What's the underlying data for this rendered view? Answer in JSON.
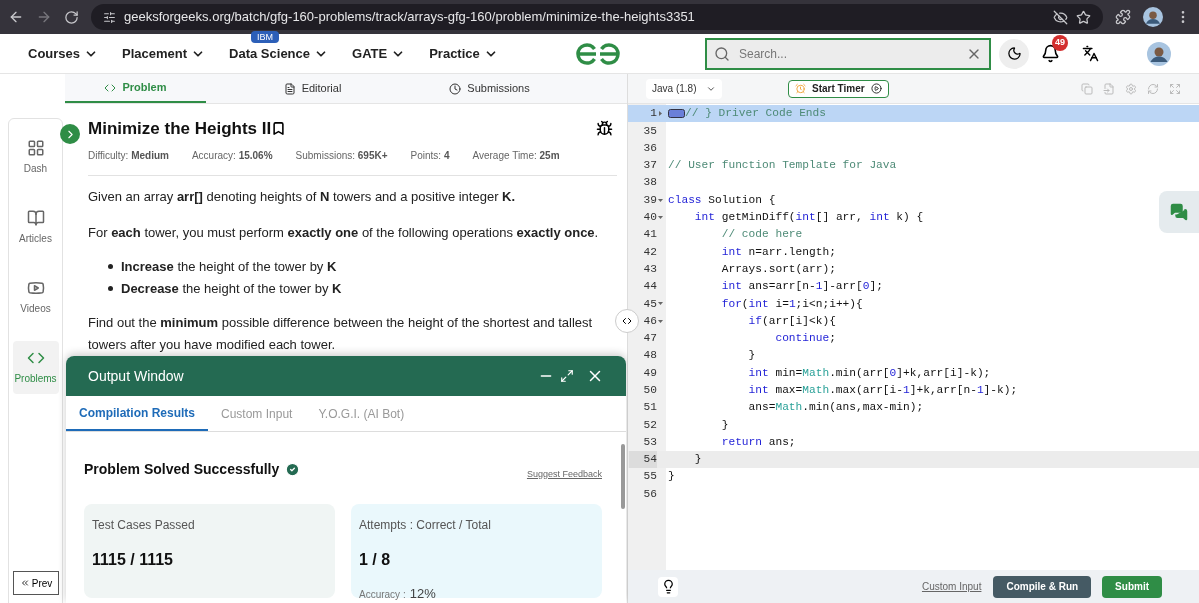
{
  "browser": {
    "url": "geeksforgeeks.org/batch/gfg-160-problems/track/arrays-gfg-160/problem/minimize-the-heights3351"
  },
  "nav": {
    "items": [
      {
        "label": "Courses"
      },
      {
        "label": "Placement"
      },
      {
        "label": "Data Science",
        "badge": "IBM"
      },
      {
        "label": "GATE"
      },
      {
        "label": "Practice"
      }
    ],
    "search": {
      "placeholder": "Search..."
    },
    "notifications": "49"
  },
  "problem_tabs": [
    {
      "label": "Problem",
      "selected": true,
      "kind": "code"
    },
    {
      "label": "Editorial",
      "selected": false,
      "kind": "doc"
    },
    {
      "label": "Submissions",
      "selected": false,
      "kind": "clock"
    }
  ],
  "sidebar": {
    "items": [
      {
        "label": "Dash",
        "kind": "dash",
        "selected": false
      },
      {
        "label": "Articles",
        "kind": "book",
        "selected": false
      },
      {
        "label": "Videos",
        "kind": "video",
        "selected": false
      },
      {
        "label": "Problems",
        "kind": "code",
        "selected": true
      }
    ],
    "prev": "Prev"
  },
  "problem": {
    "title": "Minimize the Heights II",
    "stats": [
      {
        "label": "Difficulty:",
        "value": "Medium"
      },
      {
        "label": "Accuracy:",
        "value": "15.06%"
      },
      {
        "label": "Submissions:",
        "value": "695K+"
      },
      {
        "label": "Points:",
        "value": "4"
      },
      {
        "label": "Average Time:",
        "value": "25m"
      }
    ],
    "paragraphs": [
      "Given an array **arr[]** denoting heights of **N** towers and a positive integer **K.**",
      "For **each** tower, you must perform **exactly one** of the following operations **exactly once**."
    ],
    "bullets": [
      "**Increase** the height of the tower by **K**",
      "**Decrease** the height of the tower by **K**"
    ],
    "closing": "Find out the **minimum** possible difference between the height of the shortest and tallest towers after you have modified each tower."
  },
  "output_window": {
    "title": "Output Window",
    "tabs": [
      {
        "label": "Compilation Results",
        "selected": true
      },
      {
        "label": "Custom Input",
        "selected": false
      },
      {
        "label": "Y.O.G.I. (AI Bot)",
        "selected": false
      }
    ],
    "status": "Problem Solved Successfully",
    "feedback": "Suggest Feedback",
    "cards": [
      {
        "kind": "tests",
        "label": "Test Cases Passed",
        "value": "1115 / 1115"
      },
      {
        "kind": "attempts",
        "label": "Attempts : Correct / Total",
        "value": "1 / 8",
        "accuracy_label": "Accuracy :",
        "accuracy": "12%"
      }
    ]
  },
  "editor": {
    "language": "Java (1.8)",
    "timer": "Start Timer",
    "lines": [
      {
        "number": "1",
        "fold": true,
        "selected": true,
        "cursor": false,
        "collapsed": true,
        "tokens": [
          {
            "text": "// } Driver Code Ends",
            "kind": "comment"
          }
        ]
      },
      {
        "number": "35",
        "fold": false,
        "selected": false,
        "cursor": false,
        "collapsed": false
      },
      {
        "number": "36",
        "fold": false,
        "selected": false,
        "cursor": false,
        "collapsed": false
      },
      {
        "number": "37",
        "fold": false,
        "selected": false,
        "cursor": false,
        "collapsed": false,
        "tokens": [
          {
            "text": "// User function Template for Java",
            "kind": "comment"
          }
        ]
      },
      {
        "number": "38",
        "fold": false,
        "selected": false,
        "cursor": false,
        "collapsed": false
      },
      {
        "number": "39",
        "fold": true,
        "selected": false,
        "cursor": false,
        "collapsed": false,
        "tokens": [
          {
            "text": "class",
            "kind": "keyword"
          },
          {
            "text": " Solution {",
            "kind": "plain"
          }
        ]
      },
      {
        "number": "40",
        "fold": true,
        "selected": false,
        "cursor": false,
        "collapsed": false,
        "tokens": [
          {
            "text": "    int",
            "kind": "keyword"
          },
          {
            "text": " getMinDiff(",
            "kind": "plain"
          },
          {
            "text": "int",
            "kind": "keyword"
          },
          {
            "text": "[] arr, ",
            "kind": "plain"
          },
          {
            "text": "int",
            "kind": "keyword"
          },
          {
            "text": " k) {",
            "kind": "plain"
          }
        ]
      },
      {
        "number": "41",
        "fold": false,
        "selected": false,
        "cursor": false,
        "collapsed": false,
        "tokens": [
          {
            "text": "        // code here",
            "kind": "comment"
          }
        ]
      },
      {
        "number": "42",
        "fold": false,
        "selected": false,
        "cursor": false,
        "collapsed": false,
        "tokens": [
          {
            "text": "        int",
            "kind": "keyword"
          },
          {
            "text": " n=arr.length;",
            "kind": "plain"
          }
        ]
      },
      {
        "number": "43",
        "fold": false,
        "selected": false,
        "cursor": false,
        "collapsed": false,
        "tokens": [
          {
            "text": "        Arrays.sort(arr);",
            "kind": "plain"
          }
        ]
      },
      {
        "number": "44",
        "fold": false,
        "selected": false,
        "cursor": false,
        "collapsed": false,
        "tokens": [
          {
            "text": "        int",
            "kind": "keyword"
          },
          {
            "text": " ans=arr[n-",
            "kind": "plain"
          },
          {
            "text": "1",
            "kind": "number"
          },
          {
            "text": "]-arr[",
            "kind": "plain"
          },
          {
            "text": "0",
            "kind": "number"
          },
          {
            "text": "];",
            "kind": "plain"
          }
        ]
      },
      {
        "number": "45",
        "fold": true,
        "selected": false,
        "cursor": false,
        "collapsed": false,
        "tokens": [
          {
            "text": "        for",
            "kind": "keyword"
          },
          {
            "text": "(",
            "kind": "plain"
          },
          {
            "text": "int",
            "kind": "keyword"
          },
          {
            "text": " i=",
            "kind": "plain"
          },
          {
            "text": "1",
            "kind": "number"
          },
          {
            "text": ";i<n;i++){",
            "kind": "plain"
          }
        ]
      },
      {
        "number": "46",
        "fold": true,
        "selected": false,
        "cursor": false,
        "collapsed": false,
        "tokens": [
          {
            "text": "            if",
            "kind": "keyword"
          },
          {
            "text": "(arr[i]<k){",
            "kind": "plain"
          }
        ]
      },
      {
        "number": "47",
        "fold": false,
        "selected": false,
        "cursor": false,
        "collapsed": false,
        "tokens": [
          {
            "text": "                continue",
            "kind": "keyword"
          },
          {
            "text": ";",
            "kind": "plain"
          }
        ]
      },
      {
        "number": "48",
        "fold": false,
        "selected": false,
        "cursor": false,
        "collapsed": false,
        "tokens": [
          {
            "text": "            }",
            "kind": "plain"
          }
        ]
      },
      {
        "number": "49",
        "fold": false,
        "selected": false,
        "cursor": false,
        "collapsed": false,
        "tokens": [
          {
            "text": "            int",
            "kind": "keyword"
          },
          {
            "text": " min=",
            "kind": "plain"
          },
          {
            "text": "Math",
            "kind": "builtin"
          },
          {
            "text": ".min(arr[",
            "kind": "plain"
          },
          {
            "text": "0",
            "kind": "number"
          },
          {
            "text": "]+k,arr[i]-k);",
            "kind": "plain"
          }
        ]
      },
      {
        "number": "50",
        "fold": false,
        "selected": false,
        "cursor": false,
        "collapsed": false,
        "tokens": [
          {
            "text": "            int",
            "kind": "keyword"
          },
          {
            "text": " max=",
            "kind": "plain"
          },
          {
            "text": "Math",
            "kind": "builtin"
          },
          {
            "text": ".max(arr[i-",
            "kind": "plain"
          },
          {
            "text": "1",
            "kind": "number"
          },
          {
            "text": "]+k,arr[n-",
            "kind": "plain"
          },
          {
            "text": "1",
            "kind": "number"
          },
          {
            "text": "]-k);",
            "kind": "plain"
          }
        ]
      },
      {
        "number": "51",
        "fold": false,
        "selected": false,
        "cursor": false,
        "collapsed": false,
        "tokens": [
          {
            "text": "            ans=",
            "kind": "plain"
          },
          {
            "text": "Math",
            "kind": "builtin"
          },
          {
            "text": ".min(ans,max-min);",
            "kind": "plain"
          }
        ]
      },
      {
        "number": "52",
        "fold": false,
        "selected": false,
        "cursor": false,
        "collapsed": false,
        "tokens": [
          {
            "text": "        }",
            "kind": "plain"
          }
        ]
      },
      {
        "number": "53",
        "fold": false,
        "selected": false,
        "cursor": false,
        "collapsed": false,
        "tokens": [
          {
            "text": "        return",
            "kind": "keyword"
          },
          {
            "text": " ans;",
            "kind": "plain"
          }
        ]
      },
      {
        "number": "54",
        "fold": false,
        "selected": false,
        "cursor": true,
        "collapsed": false,
        "tokens": [
          {
            "text": "    }",
            "kind": "plain"
          }
        ]
      },
      {
        "number": "55",
        "fold": false,
        "selected": false,
        "cursor": false,
        "collapsed": false,
        "tokens": [
          {
            "text": "}",
            "kind": "plain"
          }
        ]
      },
      {
        "number": "56",
        "fold": false,
        "selected": false,
        "cursor": false,
        "collapsed": false
      }
    ]
  },
  "footer": {
    "custom_input": "Custom Input",
    "compile": "Compile & Run",
    "submit": "Submit"
  }
}
